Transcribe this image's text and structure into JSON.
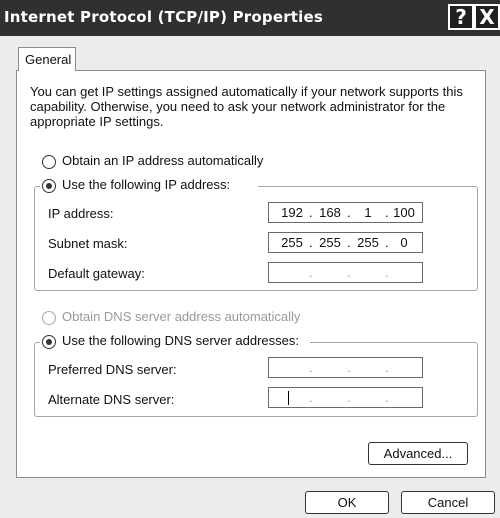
{
  "window": {
    "title": "Internet Protocol (TCP/IP) Properties",
    "help_glyph": "?",
    "close_glyph": "X"
  },
  "tabs": [
    {
      "label": "General",
      "selected": true
    }
  ],
  "description": "You can get IP settings assigned automatically if your network supports this capability. Otherwise, you need to ask your network administrator for the appropriate IP settings.",
  "ip_section": {
    "auto_option": {
      "label": "Obtain an IP address automatically",
      "selected": false
    },
    "manual_option": {
      "label": "Use the following IP address:",
      "selected": true
    },
    "fields": [
      {
        "label": "IP address:",
        "octets": [
          "192",
          "168",
          "1",
          "100"
        ]
      },
      {
        "label": "Subnet mask:",
        "octets": [
          "255",
          "255",
          "255",
          "0"
        ]
      },
      {
        "label": "Default gateway:",
        "octets": [
          "",
          "",
          "",
          ""
        ]
      }
    ]
  },
  "dns_section": {
    "auto_option": {
      "label": "Obtain DNS server address automatically",
      "selected": false,
      "enabled": false
    },
    "manual_option": {
      "label": "Use the following DNS server addresses:",
      "selected": true
    },
    "fields": [
      {
        "label": "Preferred DNS server:",
        "octets": [
          "",
          "",
          "",
          ""
        ]
      },
      {
        "label": "Alternate DNS server:",
        "octets": [
          "",
          "",
          "",
          ""
        ],
        "focused": true
      }
    ]
  },
  "buttons": {
    "advanced": "Advanced...",
    "ok": "OK",
    "cancel": "Cancel"
  }
}
